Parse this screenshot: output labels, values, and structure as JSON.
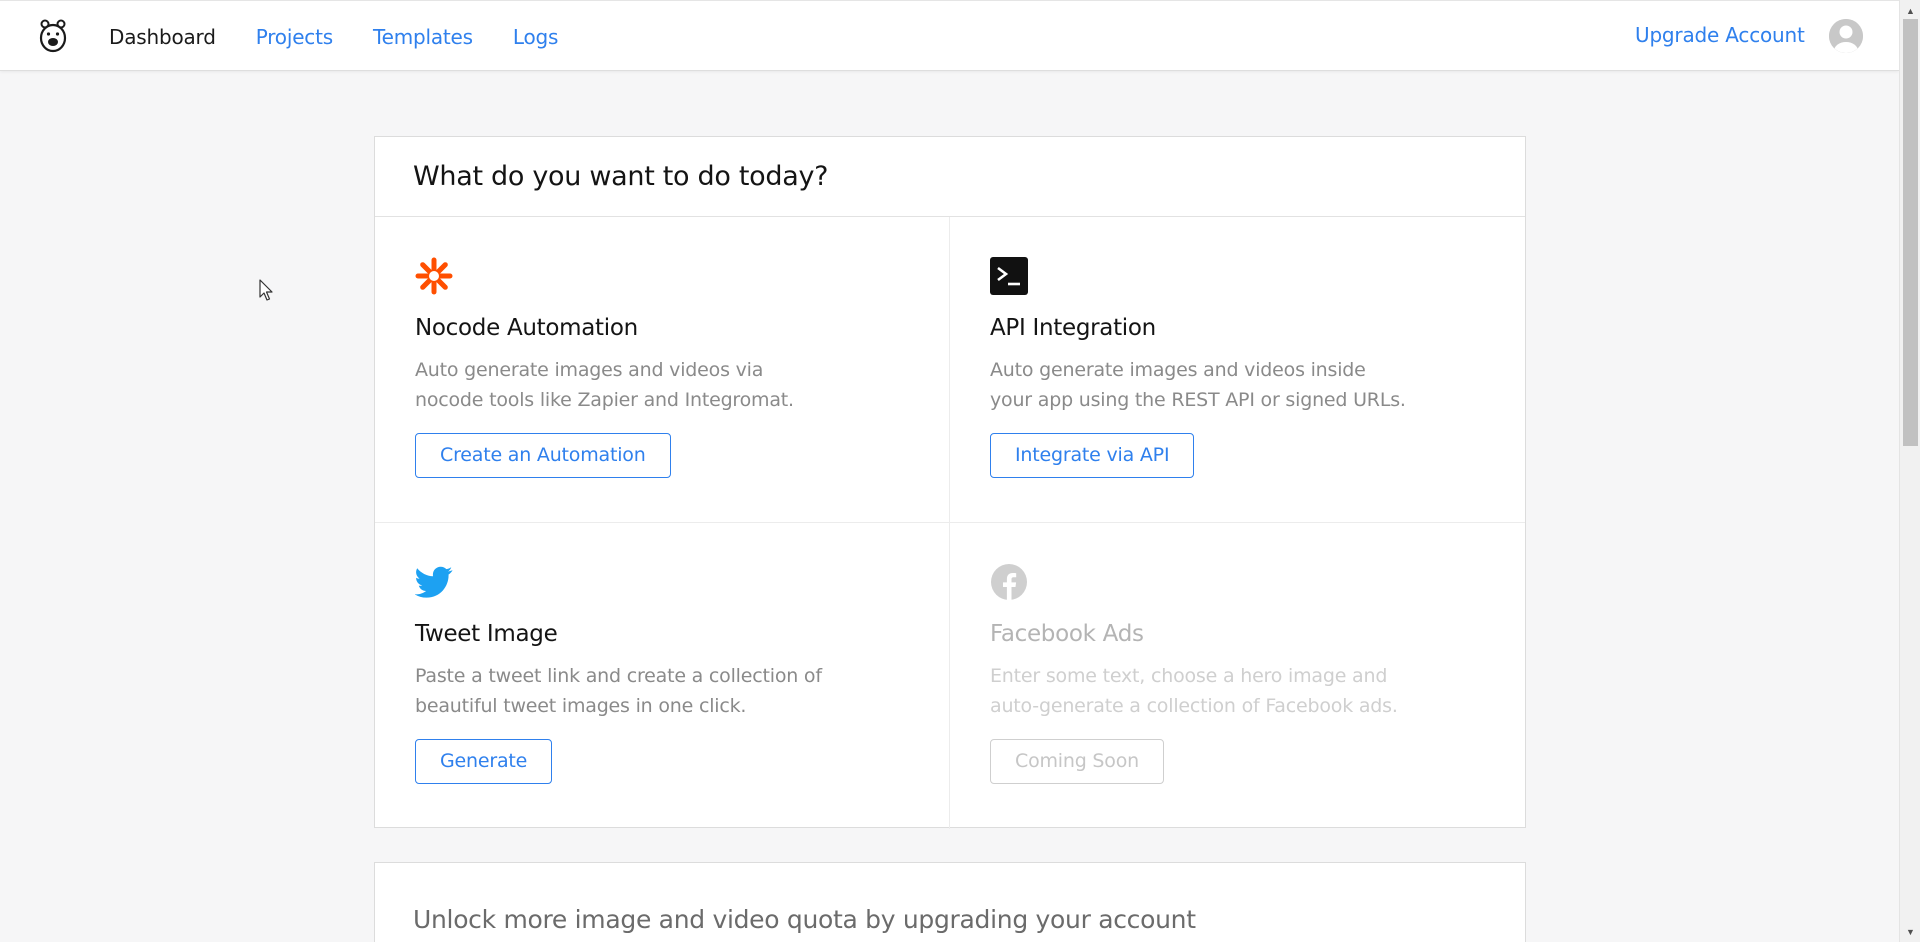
{
  "nav": {
    "items": [
      {
        "label": "Dashboard",
        "active": true
      },
      {
        "label": "Projects",
        "active": false
      },
      {
        "label": "Templates",
        "active": false
      },
      {
        "label": "Logs",
        "active": false
      }
    ],
    "upgrade_label": "Upgrade Account",
    "logo_icon": "bear-logo-icon",
    "avatar_icon": "user-avatar-icon"
  },
  "main": {
    "title": "What do you want to do today?",
    "options": [
      {
        "icon": "zapier-asterisk-icon",
        "title": "Nocode Automation",
        "description": "Auto generate images and videos via nocode tools like Zapier and Integromat.",
        "button": "Create an Automation",
        "enabled": true
      },
      {
        "icon": "terminal-icon",
        "title": "API Integration",
        "description": "Auto generate images and videos inside your app using the REST API or signed URLs.",
        "button": "Integrate via API",
        "enabled": true
      },
      {
        "icon": "twitter-icon",
        "title": "Tweet Image",
        "description": "Paste a tweet link and create a collection of beautiful tweet images in one click.",
        "button": "Generate",
        "enabled": true
      },
      {
        "icon": "facebook-icon",
        "title": "Facebook Ads",
        "description": "Enter some text, choose a hero image and auto-generate a collection of Facebook ads.",
        "button": "Coming Soon",
        "enabled": false
      }
    ]
  },
  "upgrade_card": {
    "title": "Unlock more image and video quota by upgrading your account"
  },
  "colors": {
    "accent": "#2f80ed",
    "zapier": "#ff4f00",
    "twitter": "#1da1f2",
    "disabled": "#c6c6c6"
  }
}
